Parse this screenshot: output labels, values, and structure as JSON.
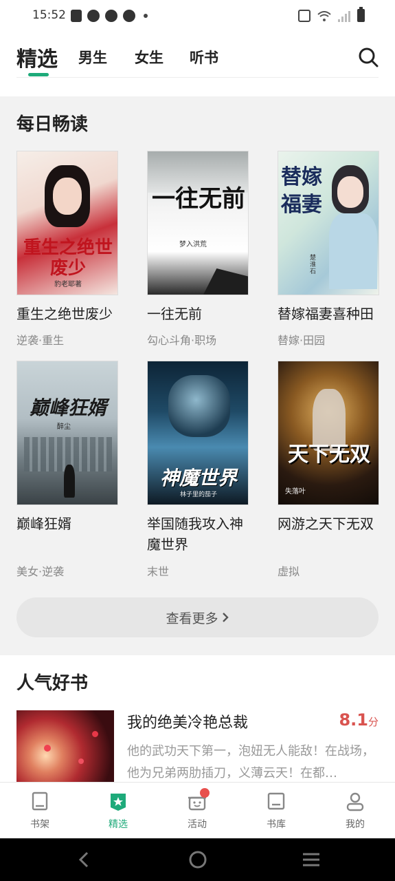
{
  "status": {
    "time": "15:52"
  },
  "nav": {
    "tabs": [
      {
        "label": "精选",
        "active": true
      },
      {
        "label": "男生",
        "active": false
      },
      {
        "label": "女生",
        "active": false
      },
      {
        "label": "听书",
        "active": false
      }
    ],
    "search_icon": "search-icon"
  },
  "daily": {
    "title": "每日畅读",
    "books": [
      {
        "title": "重生之绝世废少",
        "tags": "逆袭·重生",
        "cover_text": "重生之绝世废少",
        "cover_author": "豹老耶著"
      },
      {
        "title": "一往无前",
        "tags": "勾心斗角·职场",
        "cover_text": "一往无前",
        "cover_author": "梦入洪荒"
      },
      {
        "title": "替嫁福妻喜种田",
        "tags": "替嫁·田园",
        "cover_text": "替嫁福妻",
        "cover_author": "楚淮石"
      },
      {
        "title": "巅峰狂婿",
        "tags": "美女·逆袭",
        "cover_text": "巅峰狂婿",
        "cover_author": "醉尘"
      },
      {
        "title": "举国随我攻入神魔世界",
        "tags": "末世",
        "cover_text": "神魔世界",
        "cover_author": "林子里的茄子"
      },
      {
        "title": "网游之天下无双",
        "tags": "虚拟",
        "cover_text": "天下无双",
        "cover_author": "失落叶"
      }
    ],
    "more_label": "查看更多"
  },
  "popular": {
    "title": "人气好书",
    "book": {
      "title": "我的绝美冷艳总裁",
      "score": "8.1",
      "score_unit": "分",
      "desc": "他的武功天下第一，泡妞无人能敌！在战场，他为兄弟两肋插刀，义薄云天！在都…"
    }
  },
  "tabbar": {
    "items": [
      {
        "label": "书架",
        "icon": "bookshelf-icon",
        "active": false
      },
      {
        "label": "精选",
        "icon": "featured-icon",
        "active": true
      },
      {
        "label": "活动",
        "icon": "gift-icon",
        "active": false,
        "badge": true
      },
      {
        "label": "书库",
        "icon": "library-icon",
        "active": false
      },
      {
        "label": "我的",
        "icon": "profile-icon",
        "active": false
      }
    ]
  },
  "colors": {
    "accent": "#1eaa7a",
    "score": "#d9534f",
    "badge": "#e8504d"
  }
}
